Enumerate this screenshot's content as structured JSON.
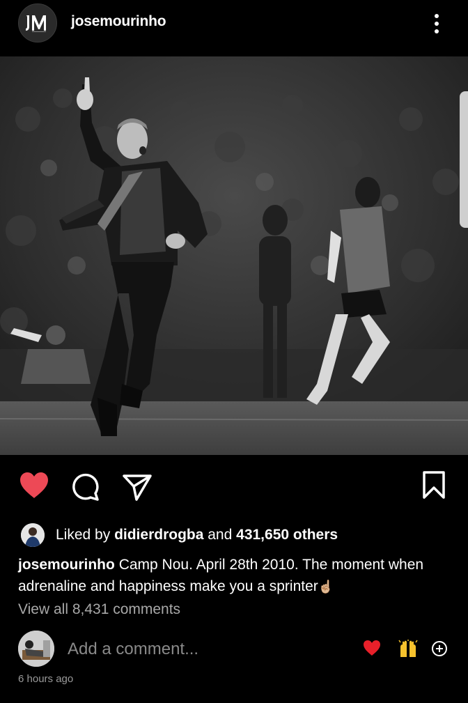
{
  "header": {
    "username": "josemourinho",
    "avatar_icon": "jm-logo-icon",
    "more_icon": "more-vertical-icon"
  },
  "post": {
    "image_icon": "post-photo"
  },
  "actions": {
    "like_icon": "heart-filled-icon",
    "comment_icon": "comment-bubble-icon",
    "share_icon": "send-paper-plane-icon",
    "save_icon": "bookmark-icon",
    "like_color": "#ed4956"
  },
  "likes": {
    "prefix": "Liked by",
    "user": "didierdrogba",
    "and": "and",
    "others": "431,650 others"
  },
  "caption": {
    "user": "josemourinho",
    "text": "Camp Nou. April 28th 2010. The moment when adrenaline and happiness make you a sprinter",
    "emoji": "☝🏼"
  },
  "comments": {
    "view_all": "View all 8,431 comments",
    "placeholder": "Add a comment...",
    "quick_heart": "❤️",
    "quick_hands": "🙌",
    "add_icon": "plus-circle-icon"
  },
  "timestamp": "6 hours ago"
}
